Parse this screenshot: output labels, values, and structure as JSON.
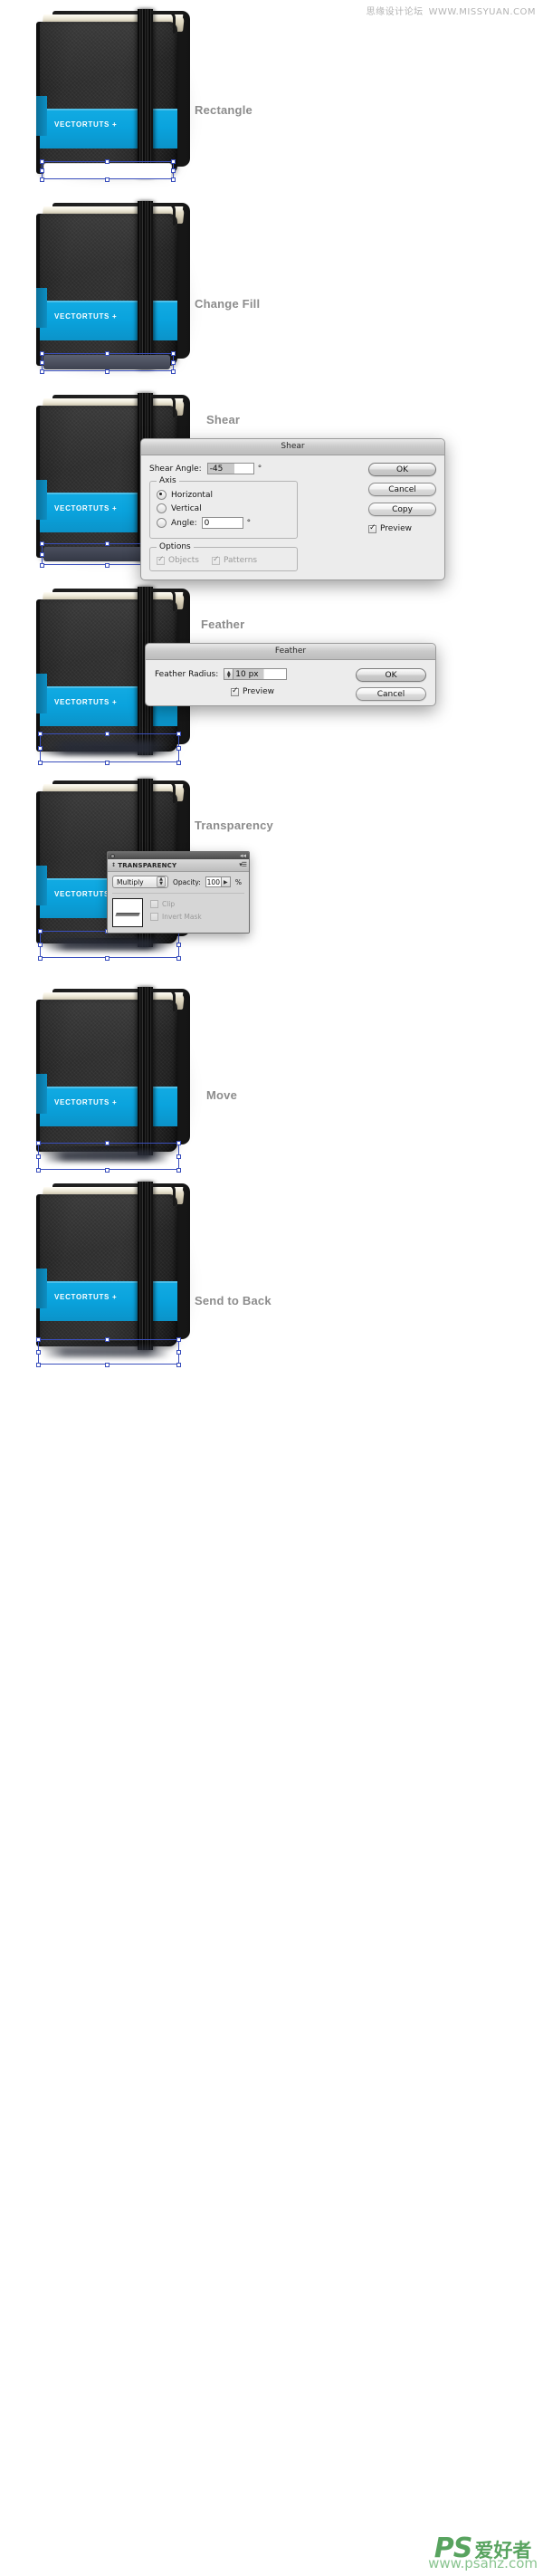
{
  "watermarks": {
    "top_cn": "思缘设计论坛",
    "top_url": "WWW.MISSYUAN.COM",
    "bottom_ps": "PS",
    "bottom_cn": "爱好者",
    "bottom_url": "www.psahz.com"
  },
  "colors": {
    "brand_blue": "#0aa3dd",
    "cover_black": "#2e2e2e",
    "pages_cream": "#ded6bf",
    "selection_blue": "#3a4fbd",
    "label_gray": "#8c8c8c",
    "watermark_green": "#4a9c52"
  },
  "book": {
    "band_label": "VECTORTUTS +"
  },
  "steps": [
    {
      "label": "Rectangle"
    },
    {
      "label": "Change Fill"
    },
    {
      "label": "Shear"
    },
    {
      "label": "Feather"
    },
    {
      "label": "Transparency"
    },
    {
      "label": "Move"
    },
    {
      "label": "Send to Back"
    }
  ],
  "shear_dialog": {
    "title": "Shear",
    "angle_label": "Shear Angle:",
    "angle_value": "-45",
    "degree_symbol": "°",
    "axis_group": "Axis",
    "horizontal_label": "Horizontal",
    "vertical_label": "Vertical",
    "angle_radio_label": "Angle:",
    "axis_angle_value": "0",
    "options_group": "Options",
    "objects_label": "Objects",
    "patterns_label": "Patterns",
    "ok_label": "OK",
    "cancel_label": "Cancel",
    "copy_label": "Copy",
    "preview_label": "Preview"
  },
  "feather_dialog": {
    "title": "Feather",
    "radius_label": "Feather Radius:",
    "radius_value": "10 px",
    "preview_label": "Preview",
    "ok_label": "OK",
    "cancel_label": "Cancel"
  },
  "transparency_panel": {
    "title": "TRANSPARENCY",
    "blend_mode": "Multiply",
    "opacity_label": "Opacity:",
    "opacity_value": "100",
    "percent_symbol": "%",
    "clip_label": "Clip",
    "invert_mask_label": "Invert Mask"
  }
}
